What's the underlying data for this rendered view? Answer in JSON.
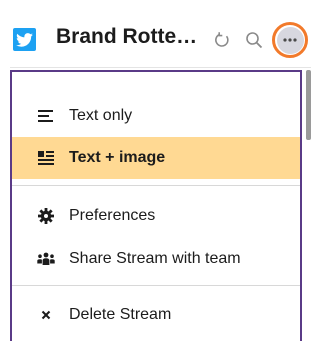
{
  "header": {
    "stream_title": "Brand Rotte…",
    "icons": [
      "twitter-icon",
      "refresh-icon",
      "search-icon",
      "more-icon"
    ],
    "accent_colors": {
      "twitter": "#1da1f2",
      "focus_ring": "#f27a2b",
      "menu_border": "#5a3a87",
      "selected_bg": "#ffd993"
    }
  },
  "menu": {
    "items": [
      {
        "label": "Text only",
        "icon": "text-lines-icon",
        "selected": false
      },
      {
        "label": "Text + image",
        "icon": "text-image-icon",
        "selected": true
      },
      {
        "label": "Preferences",
        "icon": "gear-icon",
        "selected": false
      },
      {
        "label": "Share Stream with team",
        "icon": "team-icon",
        "selected": false
      },
      {
        "label": "Delete Stream",
        "icon": "close-icon",
        "selected": false
      }
    ]
  }
}
